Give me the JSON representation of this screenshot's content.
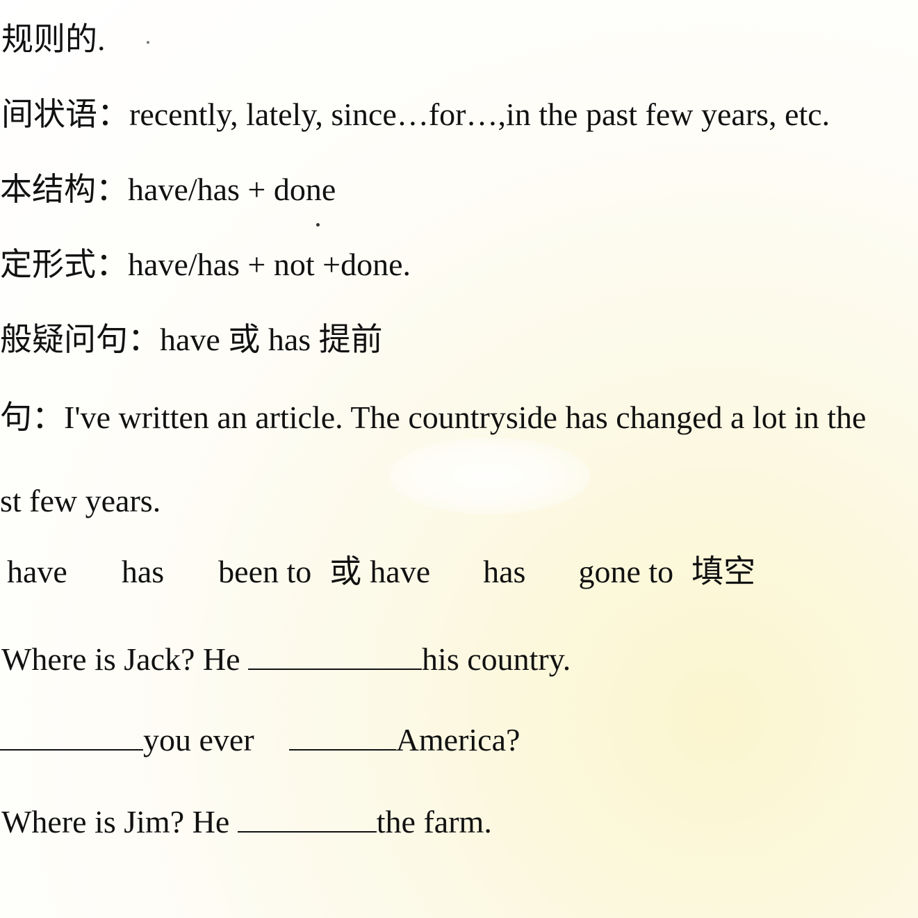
{
  "lines": {
    "rule": "规则的.",
    "time_label": "间状语：",
    "time_words": "recently, lately, since…for…,in the past few years, etc.",
    "structure_label": "本结构：",
    "structure": "have/has + done",
    "negative_label": "定形式：",
    "negative": "have/has + not +done.",
    "question_label": "般疑问句：",
    "question_a": "have",
    "question_or": "或",
    "question_b": "has",
    "question_c": "提前",
    "example_label": "句：",
    "example_text": "I've written an article. The countryside has changed a lot in the",
    "example_cont": "st few years."
  },
  "fill_header": {
    "w1": "have",
    "w2": "has",
    "w3": "been to",
    "or": "或",
    "w4": "have",
    "w5": "has",
    "w6": "gone to",
    "task": "填空"
  },
  "exercises": {
    "q1_before": "Where is Jack? He",
    "q1_after": "his country.",
    "q2_mid": "you ever",
    "q2_after": "America?",
    "q3_before": "Where is Jim? He",
    "q3_after": "the farm."
  }
}
